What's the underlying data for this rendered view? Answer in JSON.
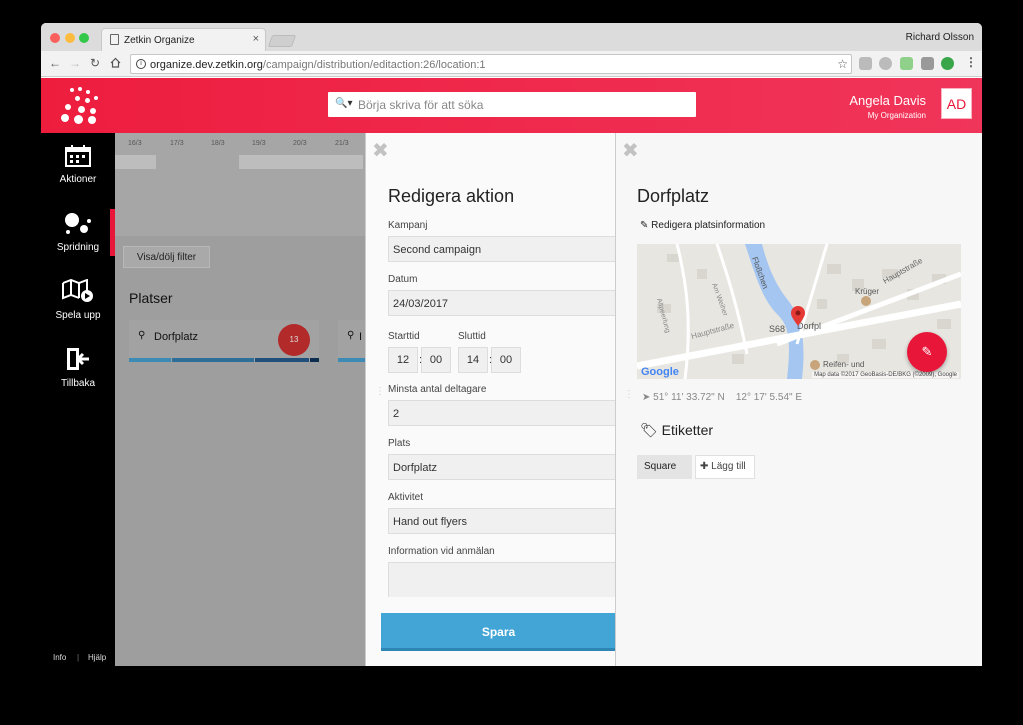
{
  "browser": {
    "tab_title": "Zetkin Organize",
    "tab_close": "×",
    "profile": "Richard Olsson",
    "url_host": "organize.dev.zetkin.org",
    "url_path": "/campaign/distribution/editaction:26/location:1",
    "icons": [
      "back-icon",
      "forward-icon",
      "reload-icon",
      "home-icon",
      "star-icon",
      "menu-icon"
    ]
  },
  "header": {
    "search_placeholder": "Börja skriva för att söka",
    "user_name": "Angela Davis",
    "org": "My Organization",
    "avatar_initials": "AD",
    "accent": "#ee1d3e"
  },
  "sidebar": {
    "items": [
      {
        "label": "Aktioner",
        "icon": "calendar-icon"
      },
      {
        "label": "Spridning",
        "icon": "dots-icon"
      },
      {
        "label": "Spela upp",
        "icon": "map-play-icon"
      },
      {
        "label": "Tillbaka",
        "icon": "exit-icon"
      }
    ],
    "footer_info": "Info",
    "footer_help": "Hjälp"
  },
  "main": {
    "dates": [
      "16/3",
      "17/3",
      "18/3",
      "19/3",
      "20/3",
      "21/3"
    ],
    "filter_button": "Visa/dölj filter",
    "section_title": "Platser",
    "locations": [
      {
        "name": "Dorfplatz",
        "count": "13"
      }
    ],
    "second_location_initial": "I"
  },
  "edit_action": {
    "title": "Redigera aktion",
    "campaign_label": "Kampanj",
    "campaign_value": "Second campaign",
    "date_label": "Datum",
    "date_value": "24/03/2017",
    "start_label": "Starttid",
    "start_hour": "12",
    "start_min": "00",
    "end_label": "Sluttid",
    "end_hour": "14",
    "end_min": "00",
    "time_sep": ":",
    "min_label": "Minsta antal deltagare",
    "min_value": "2",
    "place_label": "Plats",
    "place_value": "Dorfplatz",
    "activity_label": "Aktivitet",
    "activity_value": "Hand out flyers",
    "info_label": "Information vid anmälan",
    "info_value": "",
    "save_label": "Spara",
    "save_color": "#42a5d6"
  },
  "location_panel": {
    "title": "Dorfplatz",
    "edit_link": "Redigera platsinformation",
    "map_labels": {
      "river": "Floßchen",
      "street1": "Hauptstraße",
      "street2": "Hauptstraße",
      "street3": "Am Weiher",
      "street4": "Altpeerlung",
      "poi1": "Krüger",
      "poi2": "Reifen- und",
      "road": "S68",
      "place": "Dorfpl",
      "google": "Google",
      "attribution": "Map data ©2017 GeoBasis-DE/BKG (©2009), Google"
    },
    "lat": "51° 11' 33.72\" N",
    "lng": "12° 17' 5.54\" E",
    "tags_title": "Etiketter",
    "tag": "Square",
    "add_tag": "Lägg till"
  }
}
